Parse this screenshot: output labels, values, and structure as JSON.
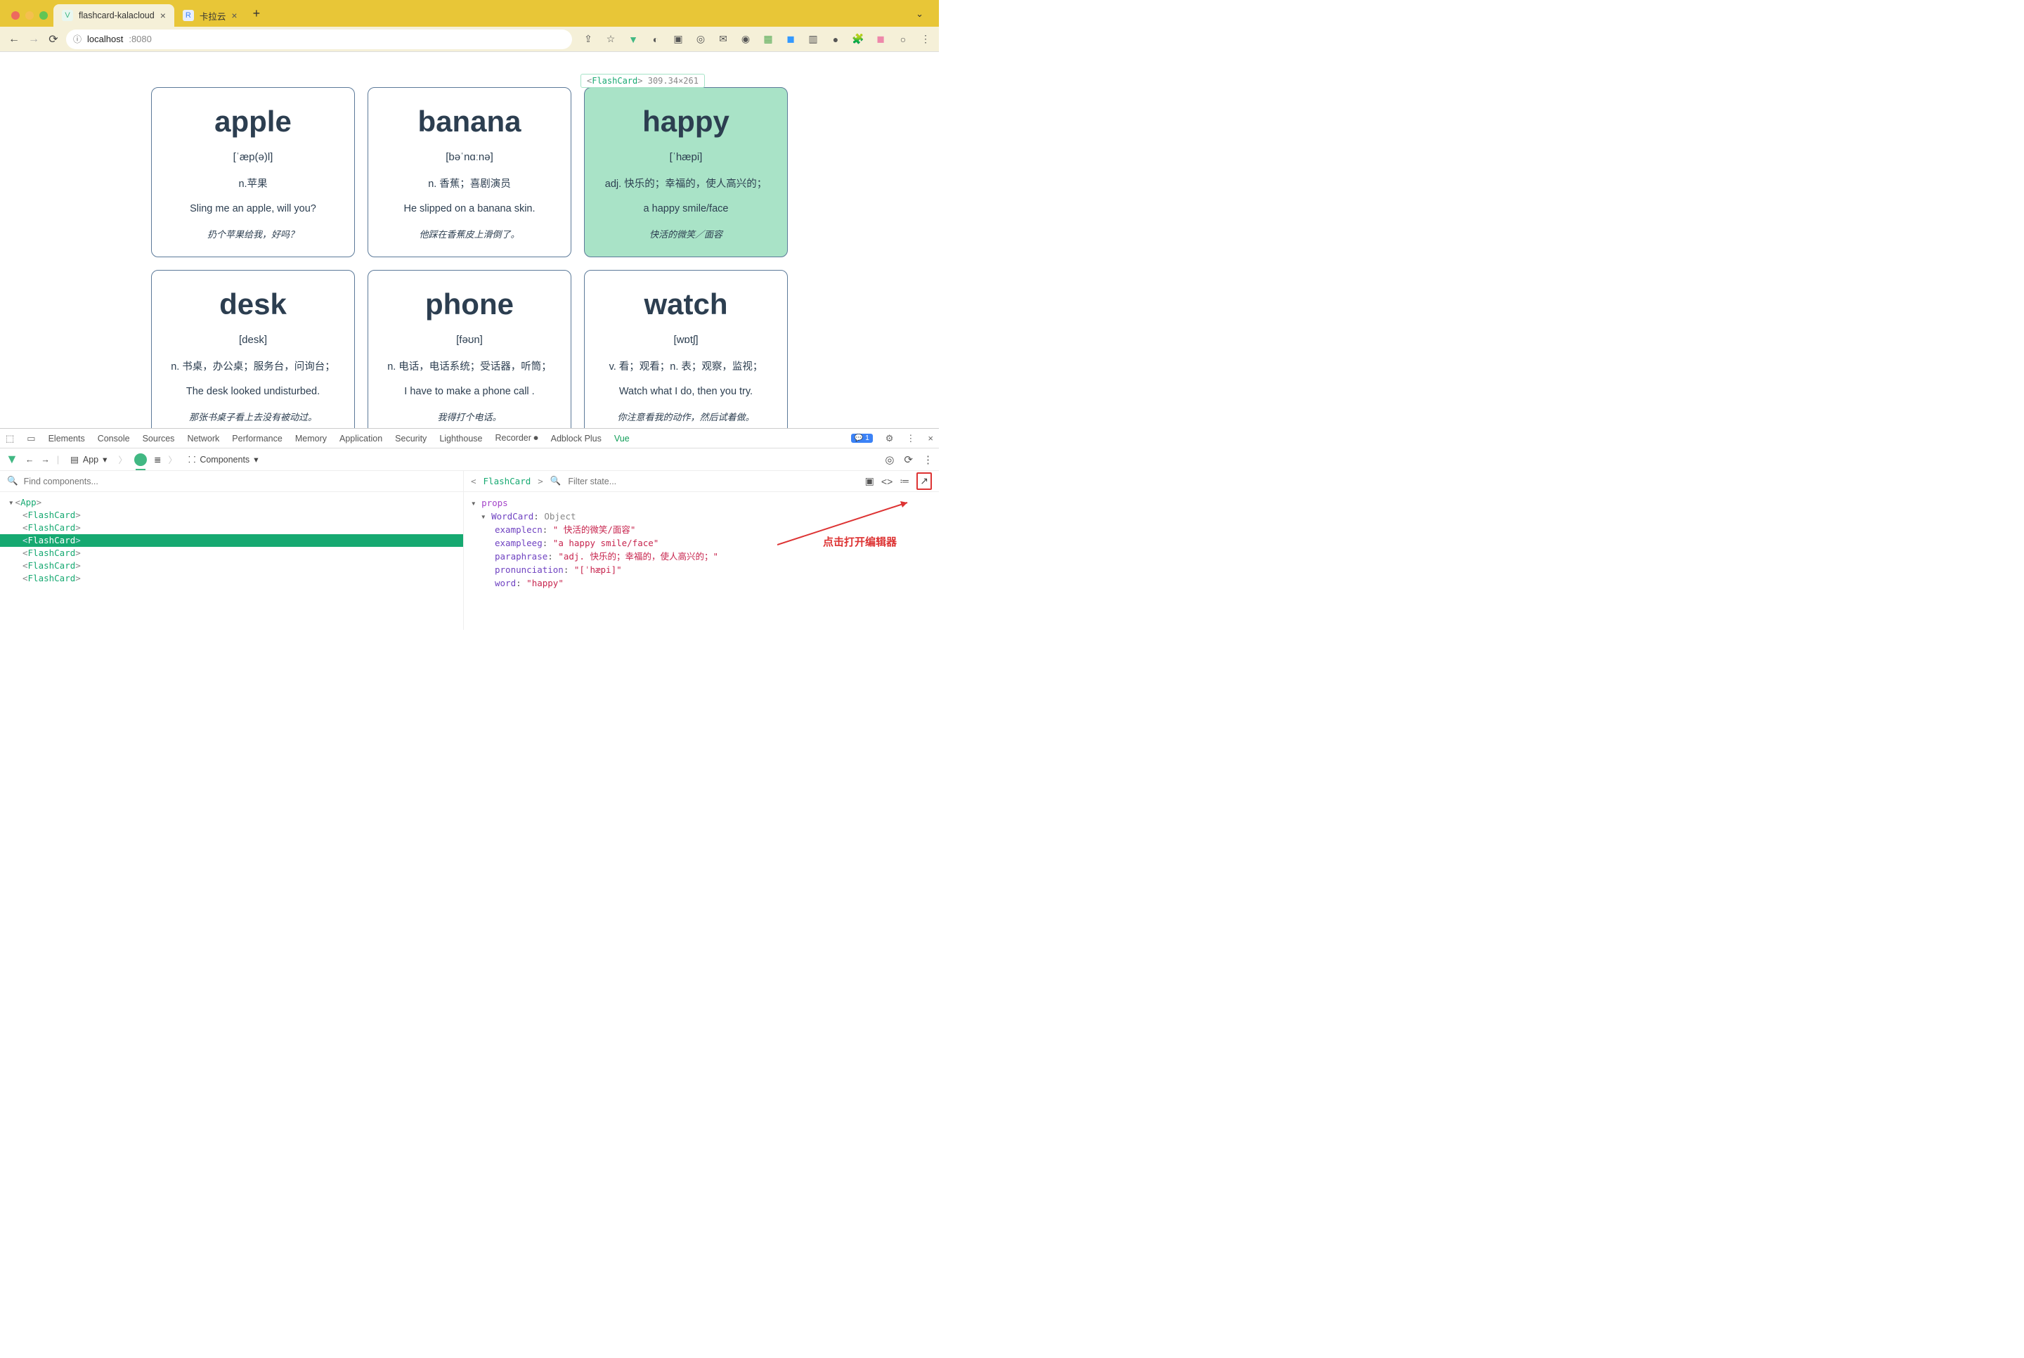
{
  "browser": {
    "tabs": [
      {
        "title": "flashcard-kalacloud",
        "favicon_color": "#41b883",
        "favicon_glyph": "V",
        "active": true
      },
      {
        "title": "卡拉云",
        "favicon_color": "#3b82f6",
        "favicon_glyph": "R",
        "active": false
      }
    ],
    "url_host": "localhost",
    "url_port": ":8080"
  },
  "inspector_pill": {
    "component": "FlashCard",
    "dims": "309.34×261"
  },
  "cards": [
    {
      "word": "apple",
      "pron": "[ˈæp(ə)l]",
      "para": "n.苹果",
      "eg": "Sling me an apple, will you?",
      "cn": "扔个苹果给我，好吗？",
      "hl": false
    },
    {
      "word": "banana",
      "pron": "[bəˈnɑːnə]",
      "para": "n. 香蕉；喜剧演员",
      "eg": "He slipped on a banana skin.",
      "cn": "他踩在香蕉皮上滑倒了。",
      "hl": false
    },
    {
      "word": "happy",
      "pron": "[ˈhæpi]",
      "para": "adj. 快乐的；幸福的，使人高兴的；",
      "eg": "a happy smile/face",
      "cn": "快活的微笑／面容",
      "hl": true
    },
    {
      "word": "desk",
      "pron": "[desk]",
      "para": "n. 书桌，办公桌；服务台，问询台；",
      "eg": "The desk looked undisturbed.",
      "cn": "那张书桌子看上去没有被动过。",
      "hl": false
    },
    {
      "word": "phone",
      "pron": "[fəʊn]",
      "para": "n. 电话，电话系统；受话器，听筒；",
      "eg": "I have to make a phone call .",
      "cn": "我得打个电话。",
      "hl": false
    },
    {
      "word": "watch",
      "pron": "[wɒtʃ]",
      "para": "v. 看；观看；n. 表；观察，监视；",
      "eg": "Watch what I do, then you try.",
      "cn": "你注意看我的动作，然后试着做。",
      "hl": false
    }
  ],
  "devtools": {
    "tabs": [
      "Elements",
      "Console",
      "Sources",
      "Network",
      "Performance",
      "Memory",
      "Application",
      "Security",
      "Lighthouse",
      "Recorder ⏺",
      "Adblock Plus",
      "Vue"
    ],
    "active_tab": "Vue",
    "notif_count": "1",
    "vue_toolbar": {
      "app_label": "App",
      "components_label": "Components"
    },
    "find_placeholder": "Find components...",
    "filter_placeholder": "Filter state...",
    "tree": {
      "root": "App",
      "children": [
        "FlashCard",
        "FlashCard",
        "FlashCard",
        "FlashCard",
        "FlashCard",
        "FlashCard"
      ],
      "selected_index": 2
    },
    "selected_component": "FlashCard",
    "props_label": "props",
    "wordcard_label": "WordCard",
    "object_label": "Object",
    "props": {
      "examplecn": "\" 快活的微笑/面容\"",
      "exampleeg": "\"a happy smile/face\"",
      "paraphrase": "\"adj. 快乐的；幸福的，使人高兴的；\"",
      "pronunciation": "\"[ˈhæpi]\"",
      "word": "\"happy\""
    },
    "annotation": "点击打开编辑器"
  }
}
